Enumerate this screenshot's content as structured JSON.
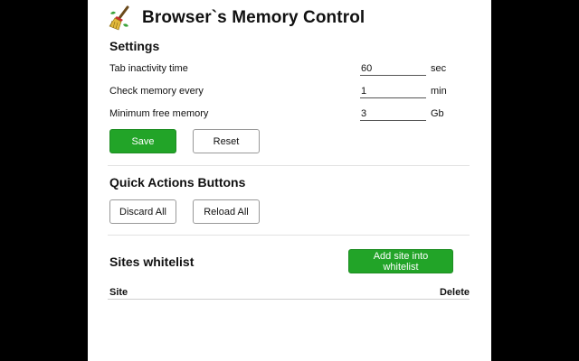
{
  "app": {
    "title": "Browser`s Memory Control",
    "logo_icon": "broom-icon"
  },
  "settings": {
    "title": "Settings",
    "rows": [
      {
        "label": "Tab inactivity time",
        "value": "60",
        "unit": "sec"
      },
      {
        "label": "Check memory every",
        "value": "1",
        "unit": "min"
      },
      {
        "label": "Minimum free memory",
        "value": "3",
        "unit": "Gb"
      }
    ],
    "save_label": "Save",
    "reset_label": "Reset"
  },
  "quick_actions": {
    "title": "Quick Actions Buttons",
    "discard_label": "Discard All",
    "reload_label": "Reload All"
  },
  "whitelist": {
    "title": "Sites whitelist",
    "add_label": "Add site into whitelist",
    "columns": [
      "Site",
      "Delete"
    ]
  },
  "colors": {
    "accent": "#22a428",
    "background": "#ffffff",
    "outer": "#000000"
  }
}
